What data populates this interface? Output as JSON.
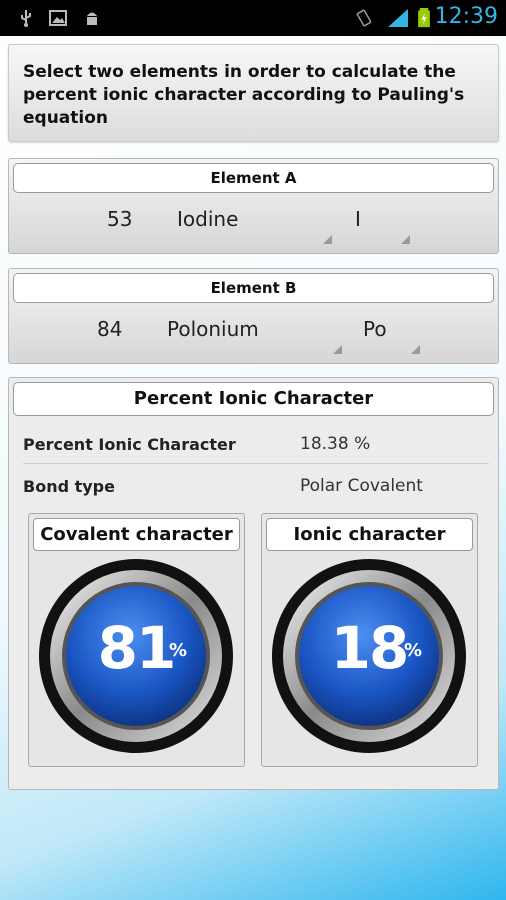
{
  "status_bar": {
    "time": "12:39",
    "left_icons": [
      "usb-icon",
      "image-icon",
      "android-debug-icon"
    ],
    "right_icons": [
      "vibrate-icon",
      "signal-icon",
      "battery-charging-icon"
    ]
  },
  "header": {
    "instruction": "Select two elements in order to calculate the percent ionic character according to Pauling's equation"
  },
  "element_a": {
    "title": "Element A",
    "atomic_number": "53",
    "name": "Iodine",
    "symbol": "I"
  },
  "element_b": {
    "title": "Element B",
    "atomic_number": "84",
    "name": "Polonium",
    "symbol": "Po"
  },
  "result": {
    "title": "Percent Ionic Character",
    "pic_label": "Percent Ionic Character",
    "pic_value": "18.38 %",
    "bond_label": "Bond type",
    "bond_value": "Polar Covalent",
    "covalent": {
      "label": "Covalent character",
      "value": "81",
      "unit": "%"
    },
    "ionic": {
      "label": "Ionic character",
      "value": "18",
      "unit": "%"
    }
  },
  "colors": {
    "accent_time": "#33b5e5",
    "gauge_blue": "#1a56c4",
    "background_bottom": "#2fb6ee"
  }
}
